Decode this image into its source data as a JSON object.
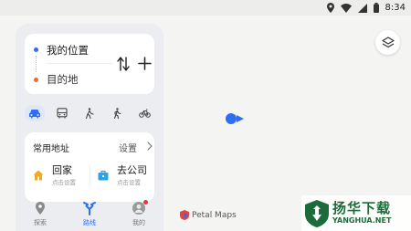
{
  "status_bar": {
    "time": "8:34",
    "icons": [
      "location-icon",
      "wifi-icon",
      "signal-icon",
      "battery-icon"
    ]
  },
  "route": {
    "start_label": "我的位置",
    "destination_label": "目的地",
    "colors": {
      "start": "#2d6ef5",
      "destination": "#f06a2a"
    }
  },
  "travel_modes": [
    {
      "name": "car-icon",
      "active": true
    },
    {
      "name": "bus-icon",
      "active": false
    },
    {
      "name": "bike-walk-icon",
      "active": false
    },
    {
      "name": "walk-icon",
      "active": false
    },
    {
      "name": "bicycle-icon",
      "active": false
    }
  ],
  "common_addresses": {
    "title": "常用地址",
    "settings_label": "设置",
    "home": {
      "name": "回家",
      "sub": "点击设置"
    },
    "work": {
      "name": "去公司",
      "sub": "点击设置"
    }
  },
  "bottom_nav": [
    {
      "label": "探索",
      "icon": "pin-icon",
      "active": false
    },
    {
      "label": "路线",
      "icon": "route-icon",
      "active": true
    },
    {
      "label": "我的",
      "icon": "profile-icon",
      "active": false
    }
  ],
  "map": {
    "brand": "Petal Maps",
    "accent": "#2d6ef5"
  },
  "watermark": {
    "title": "扬华下载",
    "sub": "YANGHUA.NET"
  }
}
